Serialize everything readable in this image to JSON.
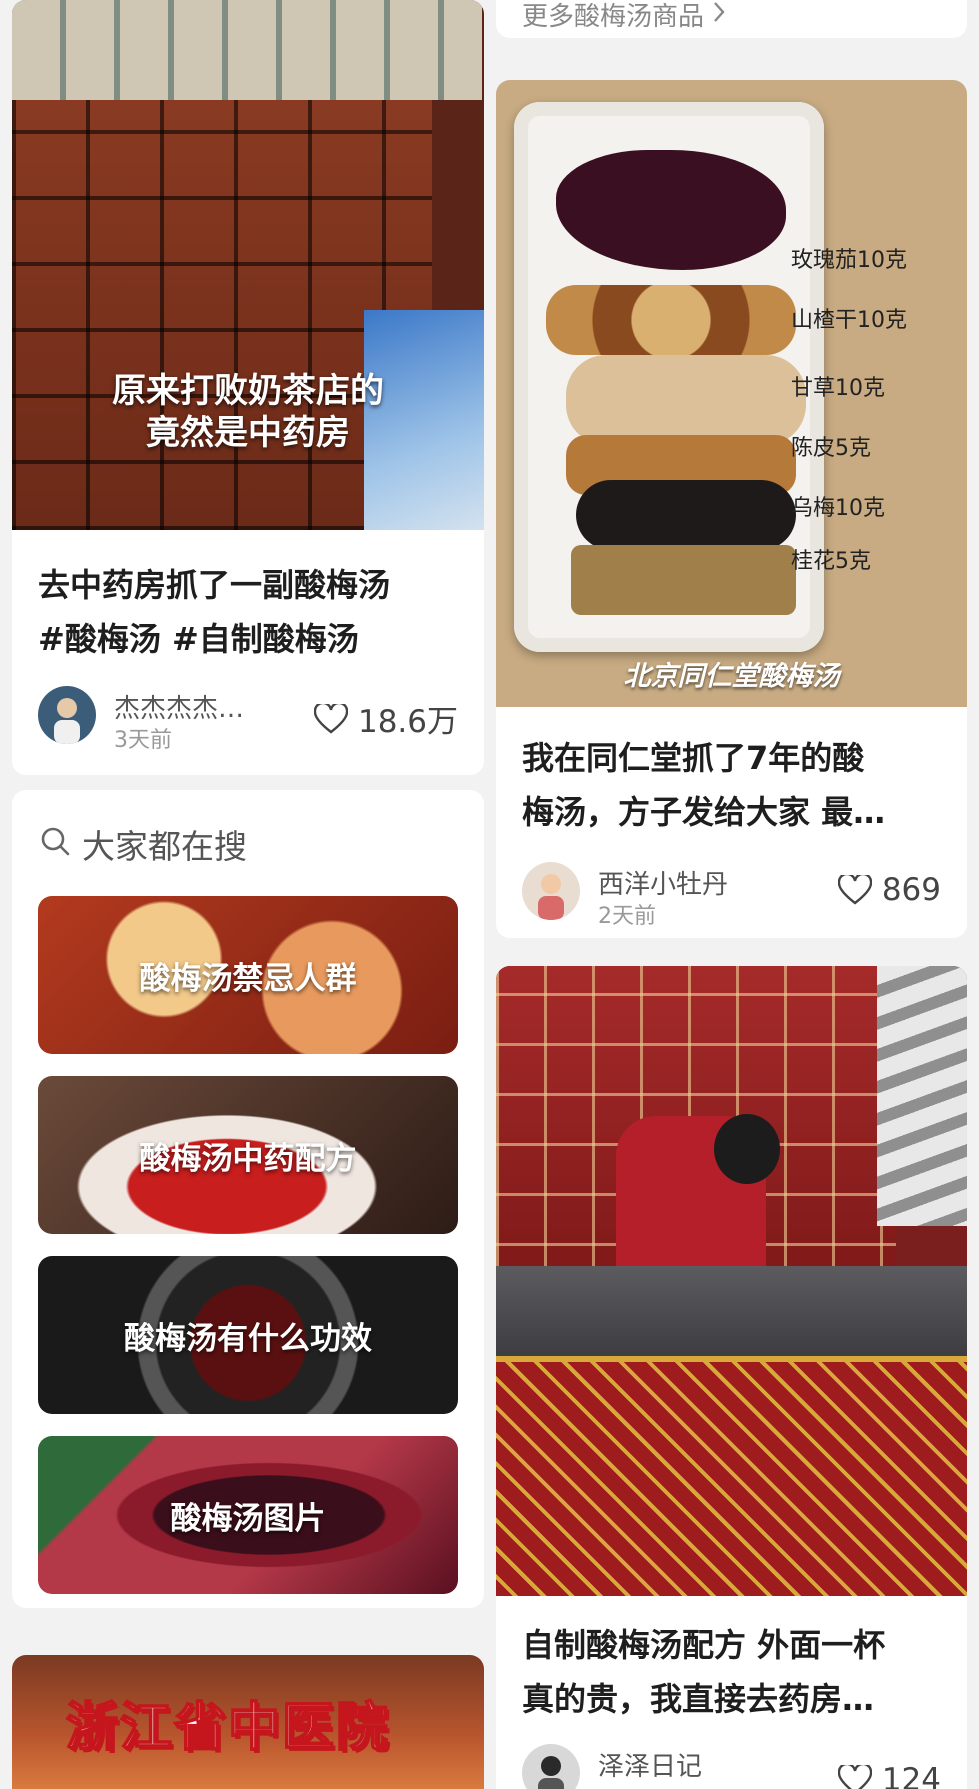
{
  "left_column": {
    "post1": {
      "overlay_line1": "原来打败奶茶店的",
      "overlay_line2": "竟然是中药房",
      "title_line1": "去中药房抓了一副酸梅汤",
      "title_line2": "#酸梅汤  #自制酸梅汤",
      "author": "杰杰杰杰…",
      "time": "3天前",
      "likes": "18.6万"
    },
    "search": {
      "heading": "大家都在搜",
      "items": [
        {
          "label": "酸梅汤禁忌人群"
        },
        {
          "label": "酸梅汤中药配方"
        },
        {
          "label": "酸梅汤有什么功效"
        },
        {
          "label": "酸梅汤图片"
        }
      ]
    },
    "post3": {
      "overlay": "浙江省中医院"
    }
  },
  "right_column": {
    "more_link": "更多酸梅汤商品",
    "post2": {
      "ingredients": [
        "玫瑰茄10克",
        "山楂干10克",
        "甘草10克",
        "陈皮5克",
        "乌梅10克",
        "桂花5克"
      ],
      "brand_caption": "北京同仁堂酸梅汤",
      "title_line1": "我在同仁堂抓了7年的酸",
      "title_line2": "梅汤，方子发给大家 最…",
      "author": "西洋小牡丹",
      "time": "2天前",
      "likes": "869"
    },
    "post4": {
      "title_line1": "自制酸梅汤配方 外面一杯",
      "title_line2": "真的贵，我直接去药房…",
      "author": "泽泽日记",
      "likes": "124"
    }
  },
  "colors": {
    "background": "#f2f2f2",
    "card": "#ffffff",
    "accent_red": "#c4161c"
  }
}
